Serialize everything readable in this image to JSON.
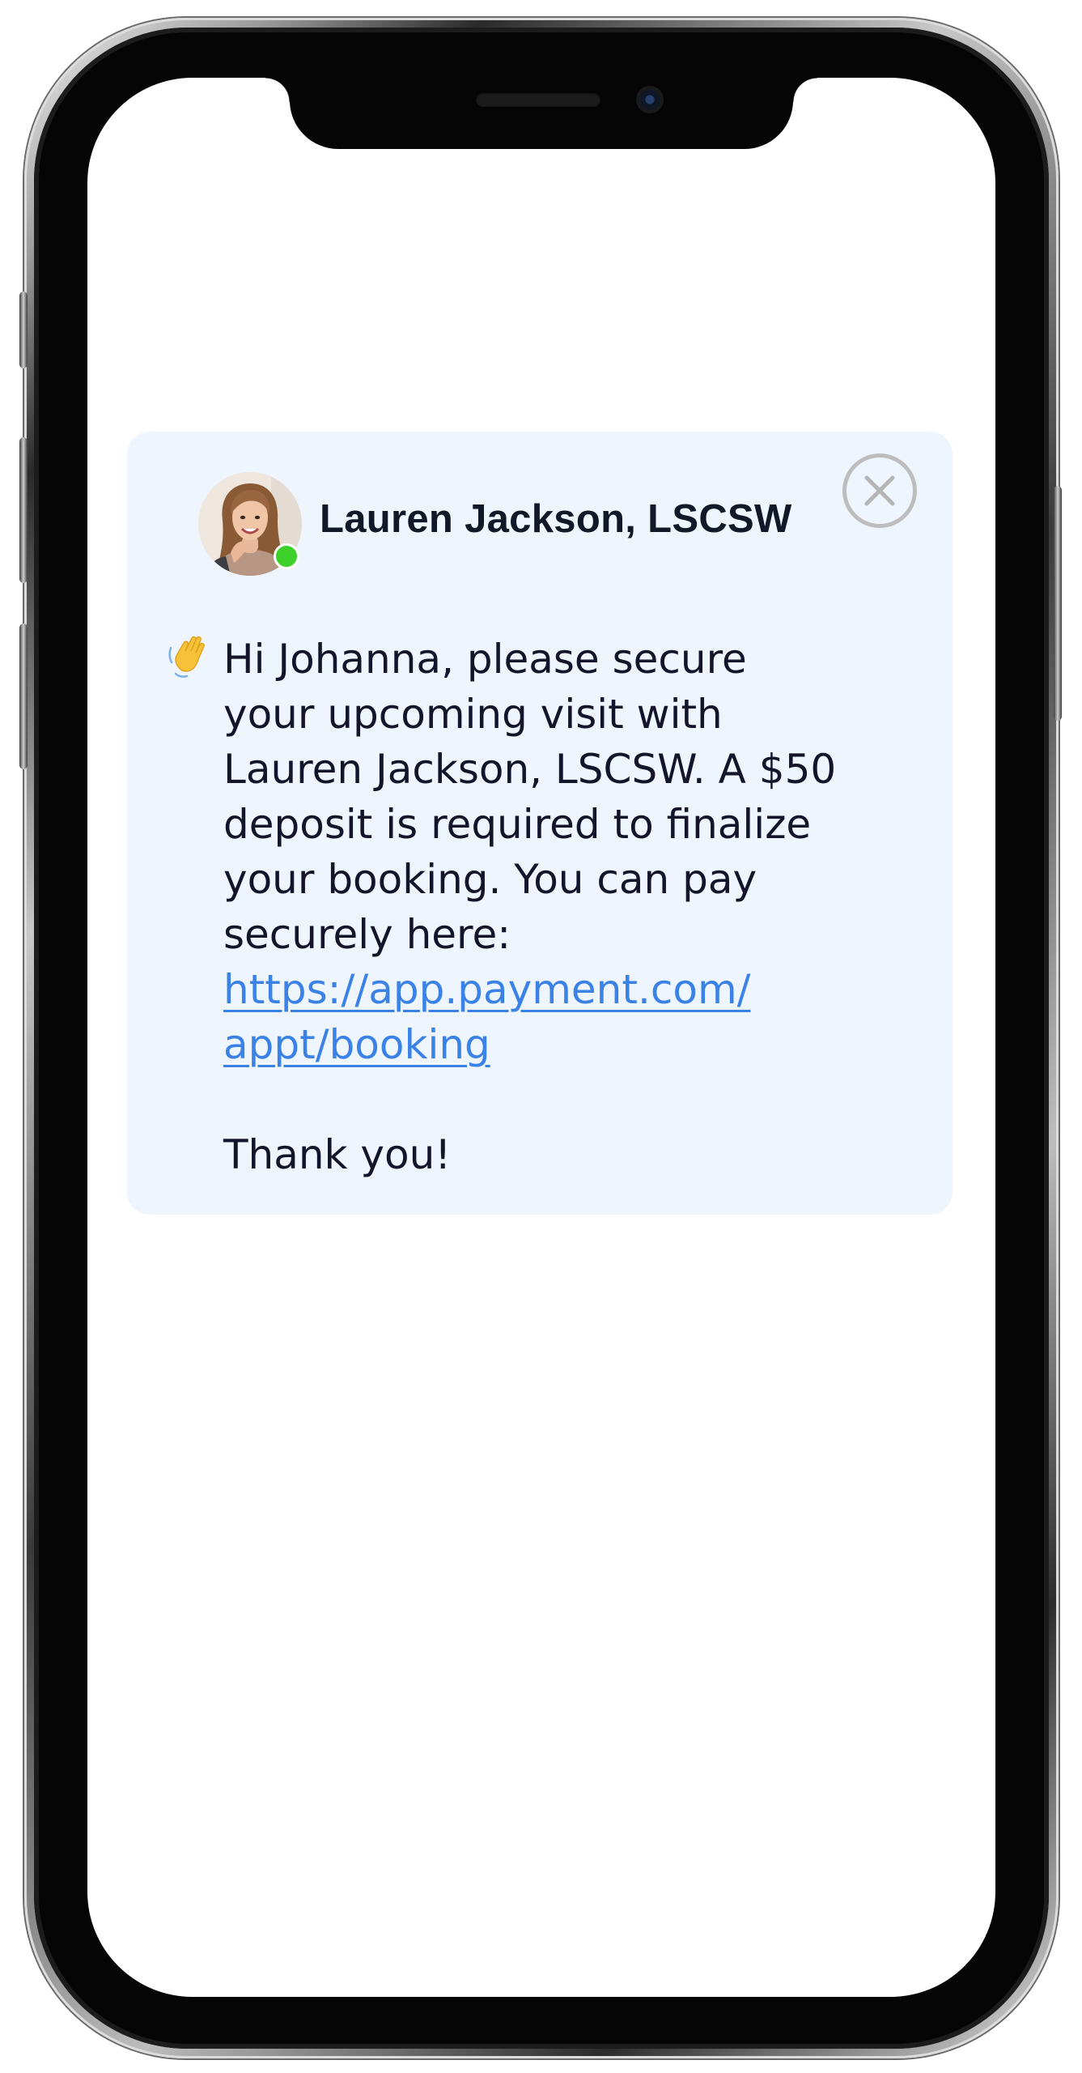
{
  "notification": {
    "sender_name": "Lauren Jackson, LSCSW",
    "status": "online",
    "status_color": "#3ed12c",
    "message_lines": [
      "Hi Johanna, please secure",
      "your upcoming visit with",
      "Lauren Jackson, LSCSW. A $50",
      "deposit is required to finalize",
      "your booking. You can pay",
      "securely here:"
    ],
    "link_lines": [
      "https://app.payment.com/",
      "appt/booking"
    ],
    "closing": "Thank you!",
    "link_color": "#3b82e6",
    "card_background": "#eef5fd",
    "icons": {
      "greeting": "waving-hand-icon",
      "close": "close-icon"
    }
  }
}
